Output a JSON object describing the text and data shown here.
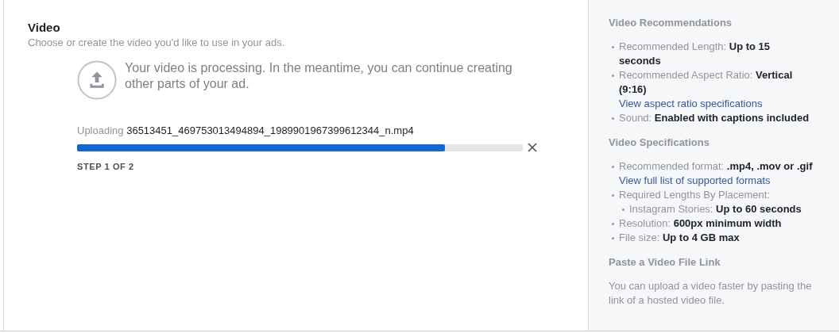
{
  "video_section": {
    "title": "Video",
    "subtitle": "Choose or create the video you'd like to use in your ads.",
    "processing_message": "Your video is processing. In the meantime, you can continue creating other parts of your ad.",
    "upload": {
      "prefix": "Uploading",
      "filename": "36513451_469753013494894_1989901967399612344_n.mp4",
      "level": 0.826
    },
    "step": "STEP 1 OF 2"
  },
  "sidebar": {
    "sections": [
      {
        "title": "Video Recommendations",
        "items": [
          {
            "text": "Recommended Length: **Up to 15 seconds**"
          },
          {
            "text": "Recommended Aspect Ratio: **Vertical (9:16)**",
            "link": "View aspect ratio specifications"
          },
          {
            "text": "Sound: **Enabled with captions included**"
          }
        ]
      },
      {
        "title": "Video Specifications",
        "items": [
          {
            "text": "Recommended format: **.mp4, .mov or .gif**",
            "link": "View full list of supported formats"
          },
          {
            "text": "Required Lengths By Placement:",
            "children": [
              {
                "text": "Instagram Stories: **Up to 60 seconds**"
              }
            ]
          },
          {
            "text": "Resolution: **600px minimum width**"
          },
          {
            "text": "File size: **Up to 4 GB max**"
          }
        ]
      },
      {
        "title": "Paste a Video File Link",
        "paragraph": "You can upload a video faster by pasting the link of a hosted video file."
      }
    ]
  }
}
